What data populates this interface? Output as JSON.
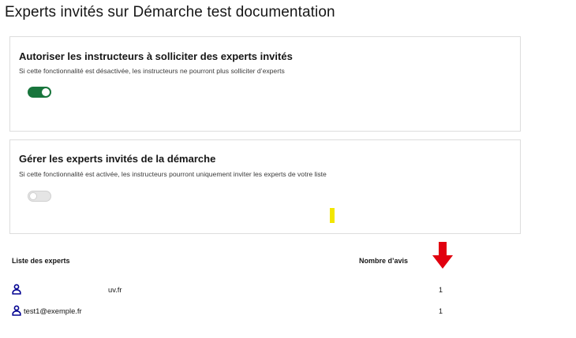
{
  "page": {
    "title": "Experts invités sur Démarche test documentation"
  },
  "cards": [
    {
      "title": "Autoriser les instructeurs à solliciter des experts invités",
      "description": "Si cette fonctionnalité est désactivée, les instructeurs ne pourront plus solliciter d’experts",
      "toggle_on": true
    },
    {
      "title": "Gérer les experts invités de la démarche",
      "description": "Si cette fonctionnalité est activée, les instructeurs pourront uniquement inviter les experts de votre liste",
      "toggle_on": false
    }
  ],
  "table": {
    "headers": {
      "experts": "Liste des experts",
      "avis": "Nombre d’avis"
    },
    "rows": [
      {
        "email": "uv.fr",
        "count": "1"
      },
      {
        "email": "test1@exemple.fr",
        "count": "1"
      }
    ]
  },
  "colors": {
    "toggle_on": "#18753c",
    "icon_blue": "#000091",
    "arrow_red": "#e1000f",
    "marker_yellow": "#f2e600"
  },
  "icons": {
    "user": "user-icon",
    "arrow": "arrow-down-icon"
  }
}
